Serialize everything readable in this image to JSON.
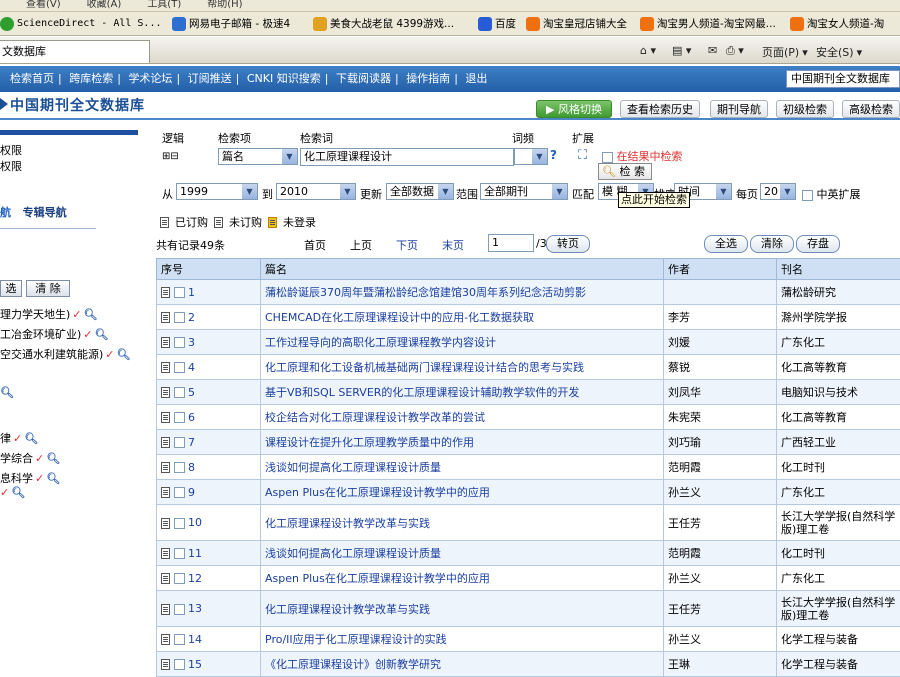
{
  "browser": {
    "menu": [
      "查看(V)",
      "收藏(A)",
      "工具(T)",
      "帮助(H)"
    ],
    "favorites": [
      {
        "label": "ScienceDirect - All S...",
        "color": "#2e9e2e"
      },
      {
        "label": "网易电子邮箱 - 极速4",
        "color": "#2c6fd1"
      },
      {
        "label": "美食大战老鼠 4399游戏...",
        "color": "#e0a020"
      },
      {
        "label": "百度",
        "color": "#2a5bd7"
      },
      {
        "label": "淘宝皇冠店铺大全",
        "color": "#f07010"
      },
      {
        "label": "淘宝男人频道-淘宝网最...",
        "color": "#f07010"
      },
      {
        "label": "淘宝女人频道-淘",
        "color": "#f07010"
      }
    ],
    "tab_title": "文数据库",
    "commands": {
      "page": "页面(P)",
      "safety": "安全(S)"
    }
  },
  "nav": {
    "links": [
      "检索首页",
      "跨库检索",
      "学术论坛",
      "订阅推送",
      "CNKI 知识搜索",
      "下载阅读器",
      "操作指南",
      "退出"
    ],
    "db_select": "中国期刊全文数据库"
  },
  "header": {
    "title": "中国期刊全文数据库",
    "buttons": {
      "style_switch": "风格切换",
      "history": "查看检索历史",
      "nav": "期刊导航",
      "basic": "初级检索",
      "advanced": "高级检索"
    }
  },
  "left": {
    "top_items": [
      "权限",
      "权限"
    ],
    "nav_title": "专辑导航",
    "buttons": {
      "select": "选",
      "clear": "清 除"
    },
    "categories": [
      "理力学天地生)",
      "工冶金环境矿业)",
      "空交通水利建筑能源)"
    ],
    "categories2": [
      "律",
      "学综合",
      "息科学"
    ]
  },
  "form": {
    "labels": {
      "logic": "逻辑",
      "item": "检索项",
      "term": "检索词",
      "freq": "词频",
      "expand": "扩展"
    },
    "field": "篇名",
    "keyword": "化工原理课程设计",
    "in_results": "在结果中检索",
    "search_btn": "检 索",
    "from_label": "从",
    "from_year": "1999",
    "to_label": "到",
    "to_year": "2010",
    "update_label": "更新",
    "update": "全部数据",
    "range_label": "范围",
    "range": "全部期刊",
    "match_label": "匹配",
    "match": "模 糊",
    "sort_label": "排序",
    "sort": "时间",
    "per_page_label": "每页",
    "per_page": "20",
    "cn_en": "中英扩展",
    "tooltip": "点此开始检索"
  },
  "legend": {
    "subscribed": "已订购",
    "unsubscribed": "未订购",
    "not_logged": "未登录"
  },
  "pager": {
    "total": "共有记录49条",
    "first": "首页",
    "prev": "上页",
    "next": "下页",
    "last": "末页",
    "page": "1",
    "of": "/3",
    "go": "转页",
    "select_all": "全选",
    "clear": "清除",
    "save": "存盘"
  },
  "table": {
    "headers": [
      "序号",
      "篇名",
      "作者",
      "刊名"
    ],
    "rows": [
      {
        "no": "1",
        "title": "蒲松龄诞辰370周年暨蒲松龄纪念馆建馆30周年系列纪念活动剪影",
        "author": "",
        "journal": "蒲松龄研究"
      },
      {
        "no": "2",
        "title": "CHEMCAD在化工原理课程设计中的应用-化工数据获取",
        "author": "李芳",
        "journal": "滁州学院学报"
      },
      {
        "no": "3",
        "title": "工作过程导向的高职化工原理课程教学内容设计",
        "author": "刘媛",
        "journal": "广东化工"
      },
      {
        "no": "4",
        "title": "化工原理和化工设备机械基础两门课程课程设计结合的思考与实践",
        "author": "蔡锐",
        "journal": "化工高等教育"
      },
      {
        "no": "5",
        "title": "基于VB和SQL SERVER的化工原理课程设计辅助教学软件的开发",
        "author": "刘凤华",
        "journal": "电脑知识与技术"
      },
      {
        "no": "6",
        "title": "校企结合对化工原理课程设计教学改革的尝试",
        "author": "朱宪荣",
        "journal": "化工高等教育"
      },
      {
        "no": "7",
        "title": "课程设计在提升化工原理教学质量中的作用",
        "author": "刘巧瑜",
        "journal": "广西轻工业"
      },
      {
        "no": "8",
        "title": "浅谈如何提高化工原理课程设计质量",
        "author": "范明霞",
        "journal": "化工时刊"
      },
      {
        "no": "9",
        "title": "Aspen Plus在化工原理课程设计教学中的应用",
        "author": "孙兰义",
        "journal": "广东化工"
      },
      {
        "no": "10",
        "title": "化工原理课程设计教学改革与实践",
        "author": "王任芳",
        "journal": "长江大学学报(自然科学版)理工卷"
      },
      {
        "no": "11",
        "title": "浅谈如何提高化工原理课程设计质量",
        "author": "范明霞",
        "journal": "化工时刊"
      },
      {
        "no": "12",
        "title": "Aspen Plus在化工原理课程设计教学中的应用",
        "author": "孙兰义",
        "journal": "广东化工"
      },
      {
        "no": "13",
        "title": "化工原理课程设计教学改革与实践",
        "author": "王任芳",
        "journal": "长江大学学报(自然科学版)理工卷"
      },
      {
        "no": "14",
        "title": "Pro/II应用于化工原理课程设计的实践",
        "author": "孙兰义",
        "journal": "化学工程与装备"
      },
      {
        "no": "15",
        "title": "《化工原理课程设计》创新教学研究",
        "author": "王琳",
        "journal": "化学工程与装备"
      }
    ]
  }
}
